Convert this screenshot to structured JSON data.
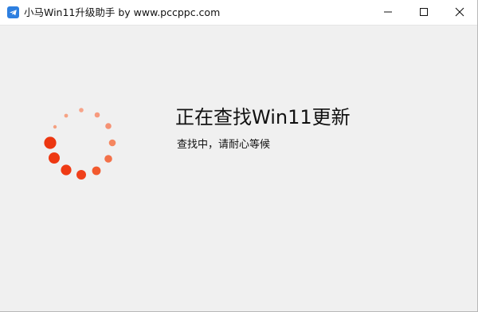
{
  "window": {
    "title": "小马Win11升级助手 by www.pccppc.com",
    "app_icon": "telegram-plane-icon",
    "controls": [
      "minimize-icon",
      "maximize-icon",
      "close-icon"
    ]
  },
  "main": {
    "heading": "正在查找Win11更新",
    "status": "查找中，请耐心等候",
    "spinner_icon": "loading-spinner-icon"
  },
  "colors": {
    "accent": "#f04a1e",
    "spinner_dark": "#f03a14",
    "spinner_light": "#f7a489",
    "titlebar": "#ffffff",
    "background": "#f0f0f0",
    "app_icon": "#2d7fe0"
  }
}
